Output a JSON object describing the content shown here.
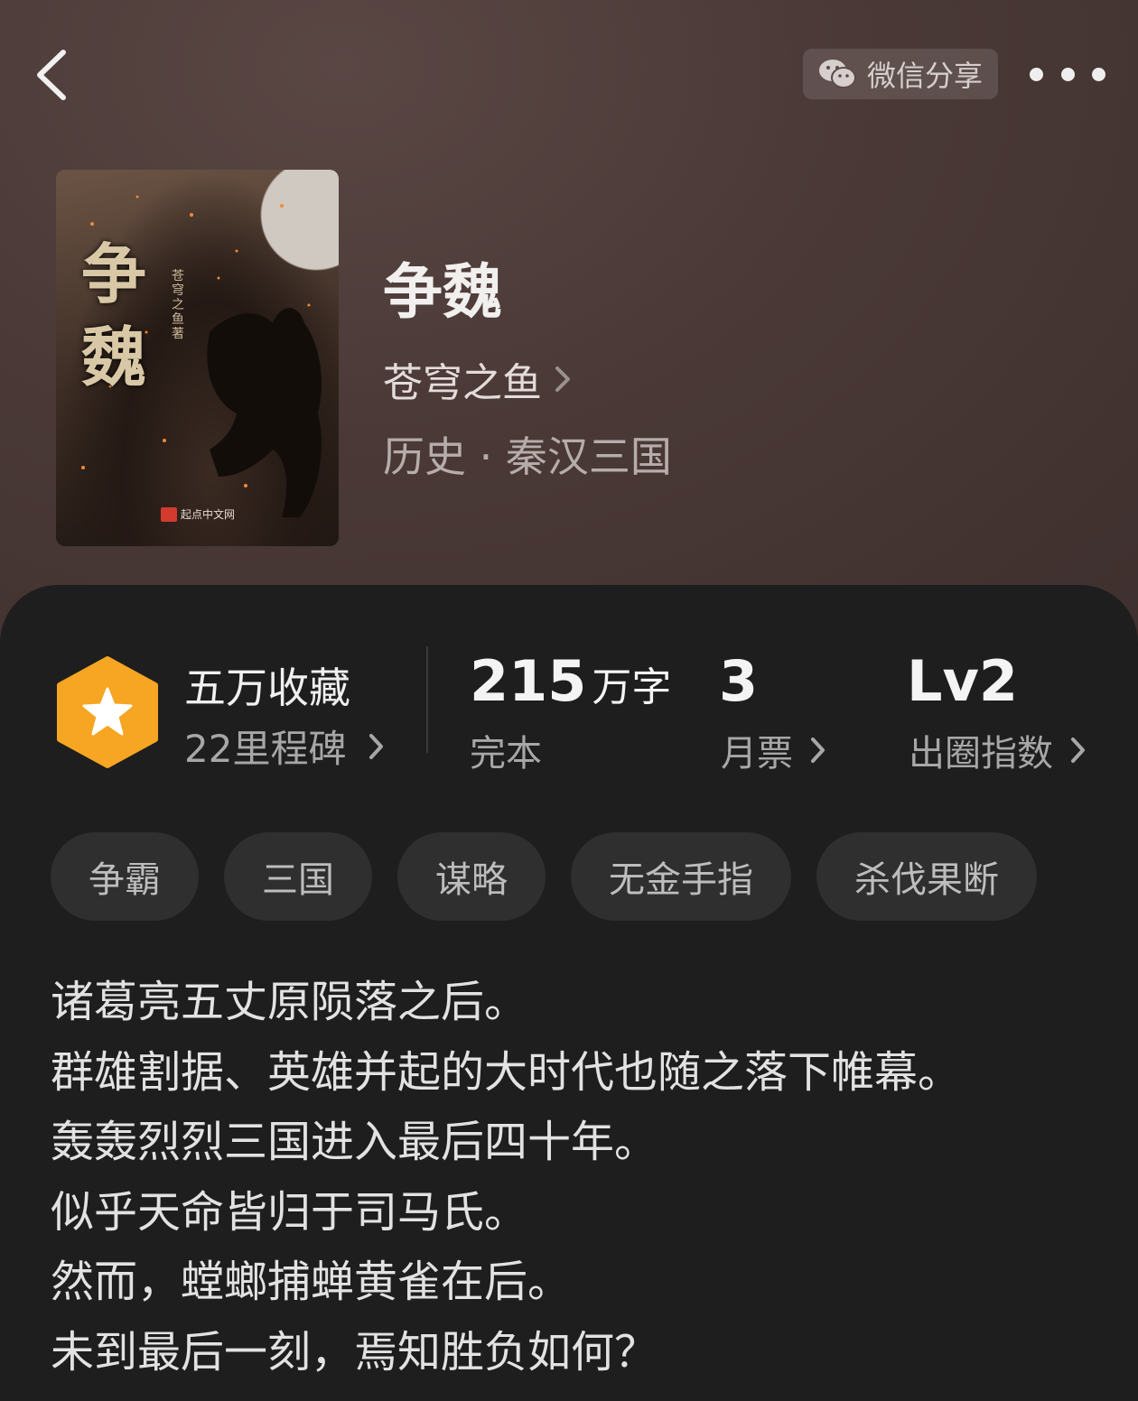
{
  "nav": {
    "share_label": "微信分享"
  },
  "book": {
    "cover_title": "争魏",
    "cover_author": "苍穹之鱼 著",
    "cover_publisher": "起点中文网",
    "title": "争魏",
    "author": "苍穹之鱼",
    "category": "历史 · 秦汉三国"
  },
  "stats": {
    "favorites": "五万收藏",
    "milestones": "22里程碑",
    "word_count": "215",
    "word_unit": "万字",
    "status": "完本",
    "monthly_tickets": "3",
    "monthly_label": "月票",
    "level": "Lv2",
    "level_label": "出圈指数"
  },
  "tags": [
    "争霸",
    "三国",
    "谋略",
    "无金手指",
    "杀伐果断"
  ],
  "synopsis": [
    "诸葛亮五丈原陨落之后。",
    "群雄割据、英雄并起的大时代也随之落下帷幕。",
    "轰轰烈烈三国进入最后四十年。",
    "似乎天命皆归于司马氏。",
    "然而，螳螂捕蝉黄雀在后。",
    "未到最后一刻，焉知胜负如何？"
  ],
  "colors": {
    "header_bg": "#4a3937",
    "panel_bg": "#1e1e1e",
    "badge_orange": "#f6a623",
    "tag_bg": "#2f2f2f"
  }
}
